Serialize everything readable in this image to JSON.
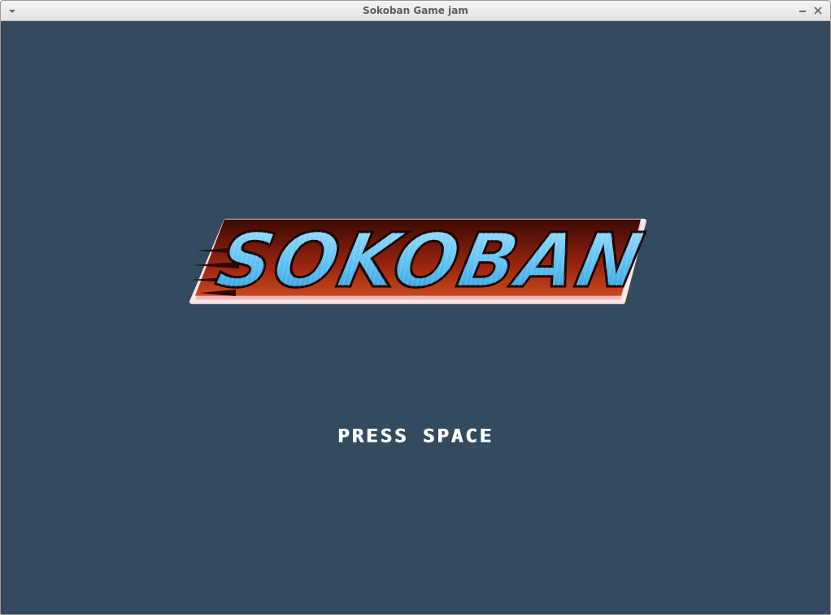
{
  "window": {
    "title": "Sokoban Game jam",
    "menu_icon": "chevron-down-icon",
    "minimize_icon": "minimize-icon",
    "close_icon": "close-icon"
  },
  "game": {
    "logo_text": "SOKOBAN",
    "prompt": "PRESS SPACE",
    "colors": {
      "background": "#344a5f",
      "logo_fill_top": "#8fd8ff",
      "logo_fill_bottom": "#3aaee8",
      "logo_shadow": "#8a1a08",
      "logo_outline": "#ffd0d0",
      "prompt": "#ffffff"
    }
  }
}
